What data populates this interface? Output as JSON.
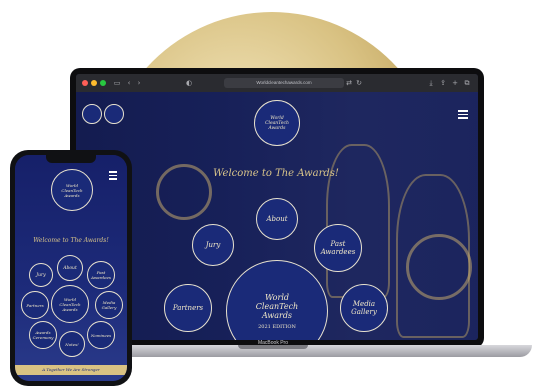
{
  "browser": {
    "url": "Worldcleantechawards.com"
  },
  "site": {
    "welcome": "Welcome to The Awards!",
    "logo_text": "World CleanTech Awards",
    "edition": "2021 EDITION",
    "nav": {
      "about": "About",
      "jury": "Jury",
      "past_awardees": "Past Awardees",
      "partners": "Partners",
      "media_gallery": "Media Gallery"
    }
  },
  "phone": {
    "welcome": "Welcome to The Awards!",
    "nav": {
      "about": "About",
      "jury": "Jury",
      "past_awardees": "Past Awardees",
      "partners": "Partners",
      "media_gallery": "Media Gallery",
      "awards_ceremony": "Awards Ceremony",
      "nominees": "Nominees",
      "notes": "Notes!"
    },
    "footer": "A Together We Are Stronger"
  },
  "device": {
    "laptop_label": "MacBook Pro"
  }
}
